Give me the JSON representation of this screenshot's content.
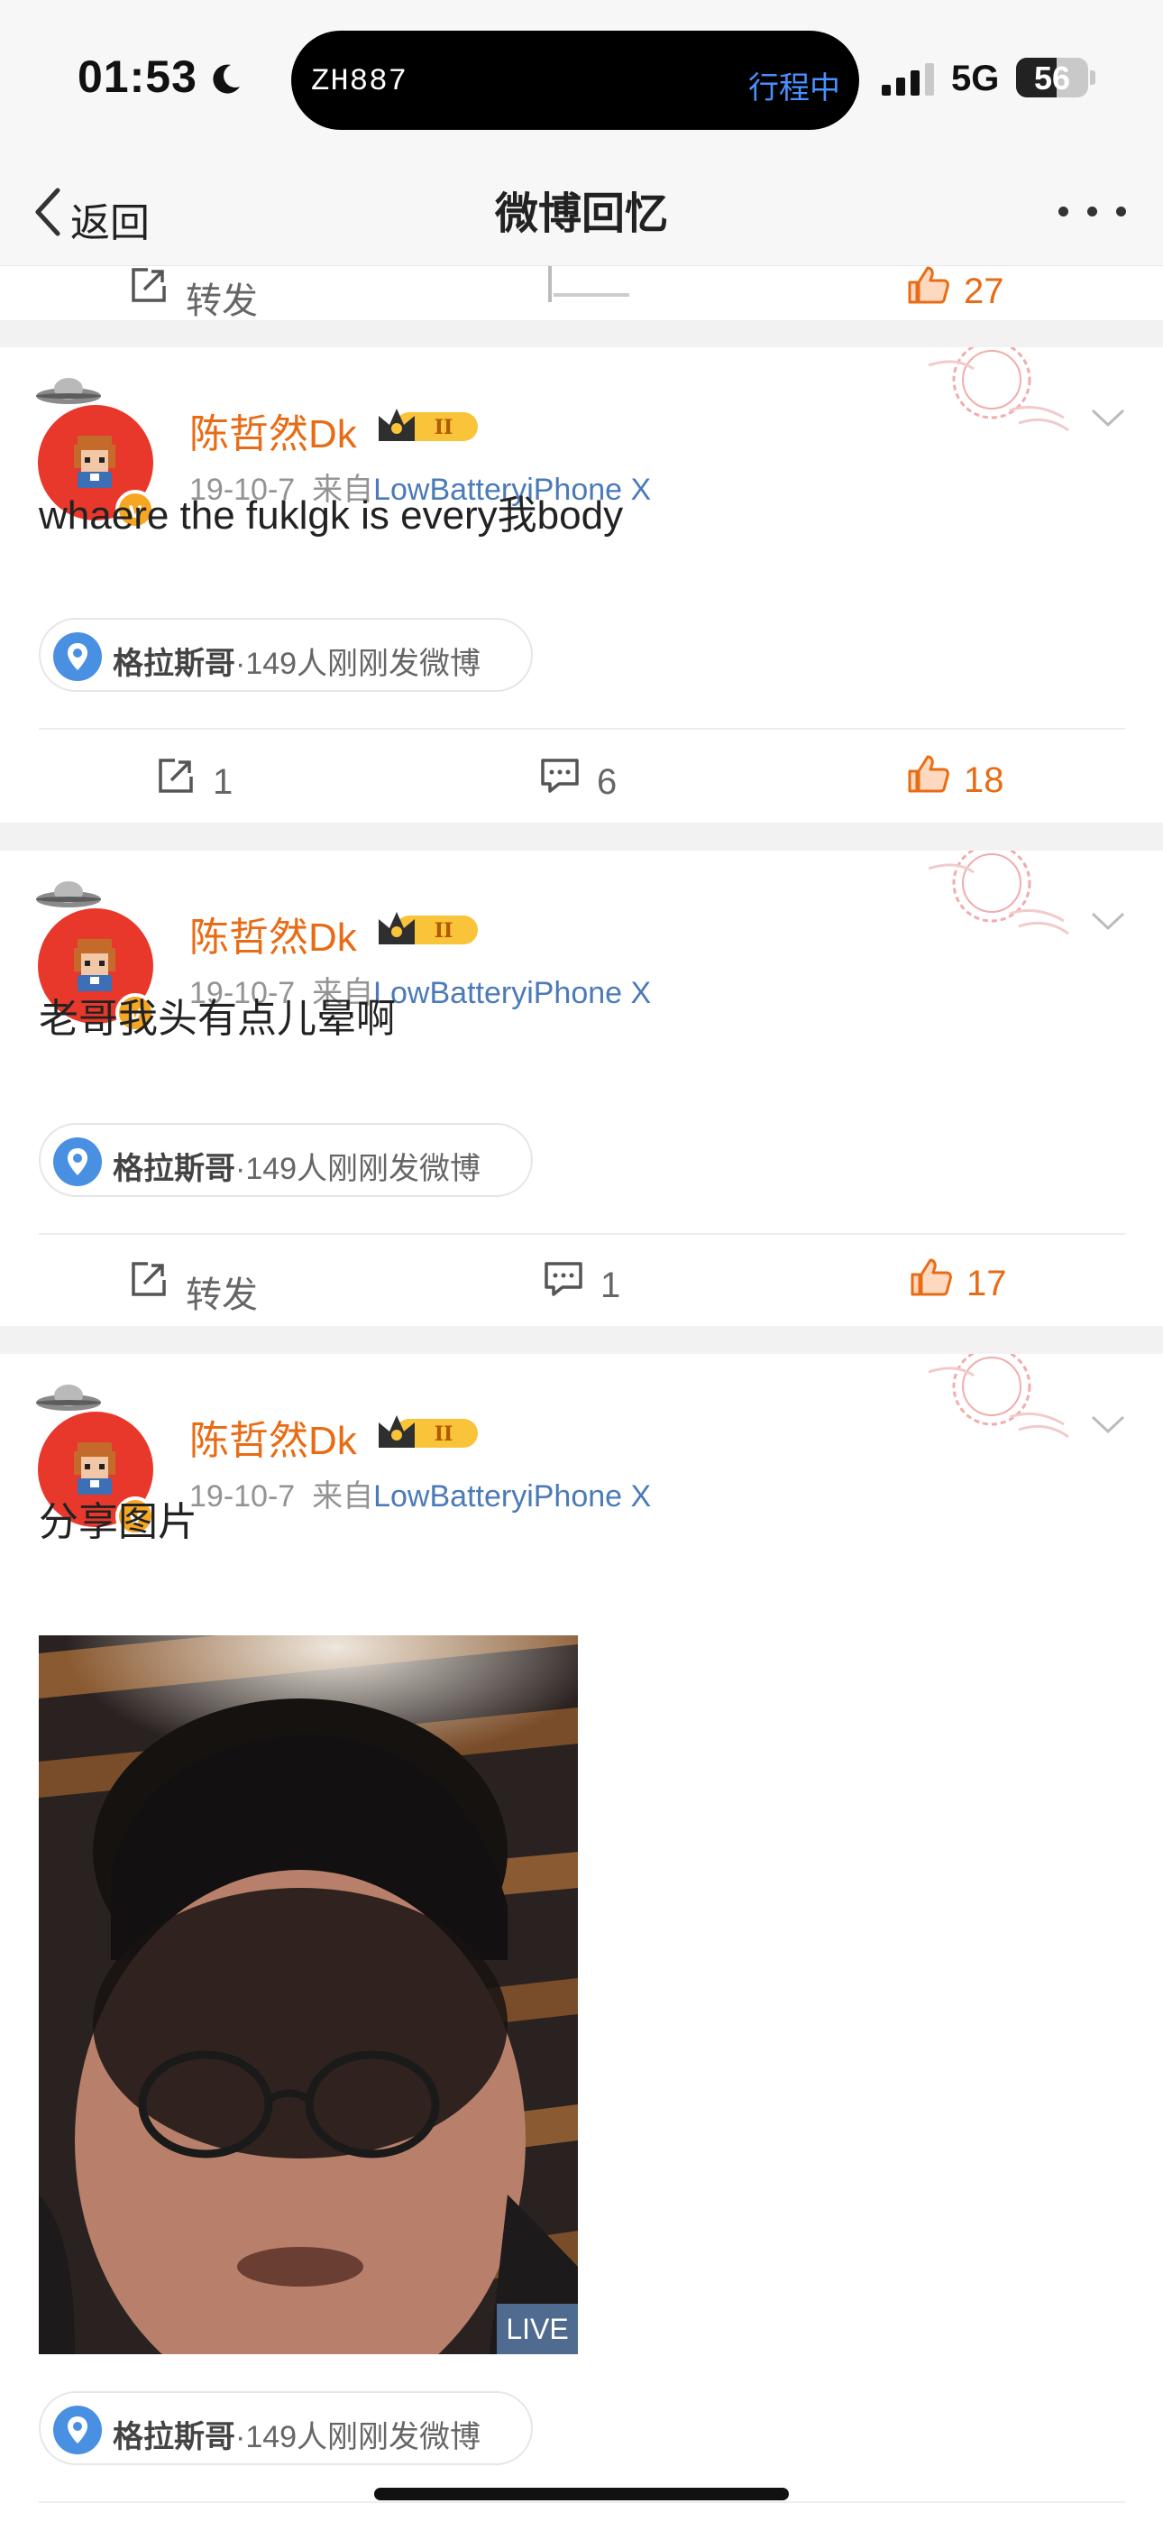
{
  "status_bar": {
    "time": "01:53",
    "island_code": "ZH887",
    "island_status": "行程中",
    "network": "5G",
    "battery": "56",
    "battery_level": 0.56
  },
  "nav": {
    "back_label": "返回",
    "title": "微博回忆"
  },
  "top_partial": {
    "repost_label": "转发",
    "like_count": "27"
  },
  "colors": {
    "accent": "#e86c15",
    "link": "#4b7ab8",
    "location_pin": "#4a90e2",
    "avatar_bg": "#e8382b"
  },
  "posts": [
    {
      "username": "陈哲然Dk",
      "date": "19-10-7",
      "source_prefix": "来自",
      "source": "LowBatteryiPhone X",
      "text": "whaere the fuklgk is every我body",
      "location": {
        "place": "格拉斯哥",
        "detail": "·149人刚刚发微博"
      },
      "actions": {
        "repost": "1",
        "comment": "6",
        "like": "18"
      }
    },
    {
      "username": "陈哲然Dk",
      "date": "19-10-7",
      "source_prefix": "来自",
      "source": "LowBatteryiPhone X",
      "text": "老哥我头有点儿晕啊",
      "location": {
        "place": "格拉斯哥",
        "detail": "·149人刚刚发微博"
      },
      "actions": {
        "repost": "转发",
        "comment": "1",
        "like": "17"
      }
    },
    {
      "username": "陈哲然Dk",
      "date": "19-10-7",
      "source_prefix": "来自",
      "source": "LowBatteryiPhone X",
      "text": "分享图片",
      "image_badge": "LIVE",
      "location": {
        "place": "格拉斯哥",
        "detail": "·149人刚刚发微博"
      }
    }
  ]
}
